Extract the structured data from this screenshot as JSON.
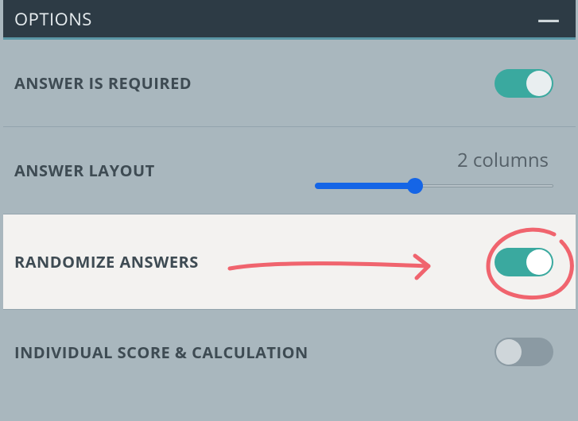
{
  "panel": {
    "title": "OPTIONS",
    "collapse_glyph": "—"
  },
  "options": {
    "required": {
      "label": "ANSWER IS REQUIRED",
      "value": true
    },
    "layout": {
      "label": "ANSWER LAYOUT",
      "value_display": "2 columns",
      "slider_percent": 42
    },
    "randomize": {
      "label": "RANDOMIZE ANSWERS",
      "value": true
    },
    "individual": {
      "label": "INDIVIDUAL SCORE & CALCULATION",
      "value": false
    }
  },
  "annotation": {
    "color": "#f0646e"
  }
}
